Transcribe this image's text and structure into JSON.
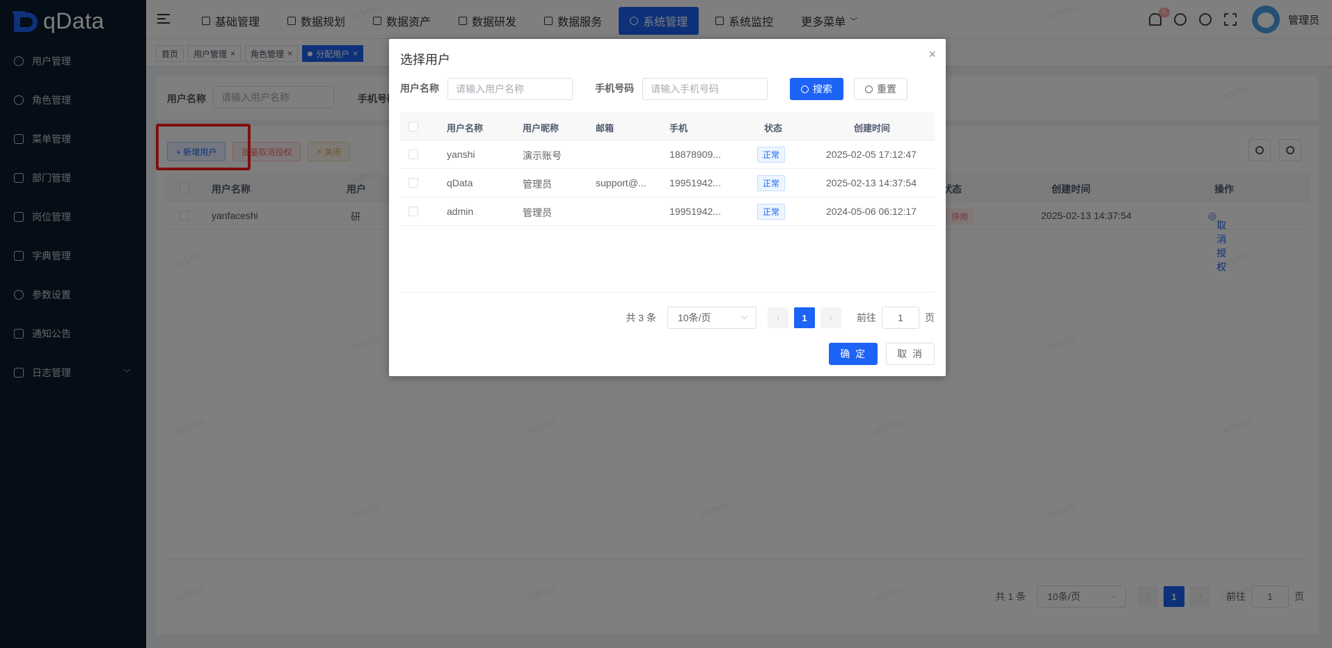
{
  "logo": {
    "text": "qData"
  },
  "sidebar": {
    "items": [
      {
        "label": "用户管理",
        "icon": "user-icon"
      },
      {
        "label": "角色管理",
        "icon": "users-icon"
      },
      {
        "label": "菜单管理",
        "icon": "menu-icon"
      },
      {
        "label": "部门管理",
        "icon": "org-icon"
      },
      {
        "label": "岗位管理",
        "icon": "post-icon"
      },
      {
        "label": "字典管理",
        "icon": "dict-icon"
      },
      {
        "label": "参数设置",
        "icon": "settings-icon"
      },
      {
        "label": "通知公告",
        "icon": "megaphone-icon"
      },
      {
        "label": "日志管理",
        "icon": "log-icon"
      }
    ]
  },
  "topnav": {
    "menus": [
      "基础管理",
      "数据规划",
      "数据资产",
      "数据研发",
      "数据服务",
      "系统管理",
      "系统监控",
      "更多菜单"
    ],
    "active": "系统管理",
    "badge": "6",
    "user": "管理员"
  },
  "tags": [
    {
      "label": "首页"
    },
    {
      "label": "用户管理"
    },
    {
      "label": "角色管理"
    },
    {
      "label": "分配用户"
    }
  ],
  "page": {
    "search": {
      "username_label": "用户名称",
      "username_placeholder": "请输入用户名称",
      "phone_label": "手机号码"
    },
    "buttons": {
      "add": "+ 新增用户",
      "batch_cancel": "批量取消授权",
      "close": "关闭"
    },
    "table": {
      "headers": [
        "用户名称",
        "用户",
        "状态",
        "创建时间",
        "操作"
      ],
      "row": {
        "username": "yanfaceshi",
        "nick": "研",
        "status": "停用",
        "created": "2025-02-13 14:37:54",
        "op": "取消授权"
      }
    },
    "pager": {
      "total": "共 1 条",
      "size": "10条/页",
      "page": "1",
      "goto": "前往",
      "goto_value": "1",
      "unit": "页"
    }
  },
  "watermark": "admin",
  "dialog": {
    "title": "选择用户",
    "close": "×",
    "username_label": "用户名称",
    "username_placeholder": "请输入用户名称",
    "phone_label": "手机号码",
    "phone_placeholder": "请输入手机号码",
    "search_btn": "搜索",
    "reset_btn": "重置",
    "headers": [
      "用户名称",
      "用户昵称",
      "邮箱",
      "手机",
      "状态",
      "创建时间"
    ],
    "rows": [
      {
        "username": "yanshi",
        "nick": "演示账号",
        "email": "",
        "phone": "18878909...",
        "status": "正常",
        "created": "2025-02-05 17:12:47"
      },
      {
        "username": "qData",
        "nick": "管理员",
        "email": "support@...",
        "phone": "19951942...",
        "status": "正常",
        "created": "2025-02-13 14:37:54"
      },
      {
        "username": "admin",
        "nick": "管理员",
        "email": "",
        "phone": "19951942...",
        "status": "正常",
        "created": "2024-05-06 06:12:17"
      }
    ],
    "pager": {
      "total": "共 3 条",
      "size": "10条/页",
      "page": "1",
      "goto": "前往",
      "goto_value": "1",
      "unit": "页"
    },
    "ok": "确 定",
    "cancel": "取 消"
  },
  "colors": {
    "primary": "#1d63f5",
    "sidebar_bg": "#0b1a2c",
    "highlight": "#ff1f1f"
  }
}
